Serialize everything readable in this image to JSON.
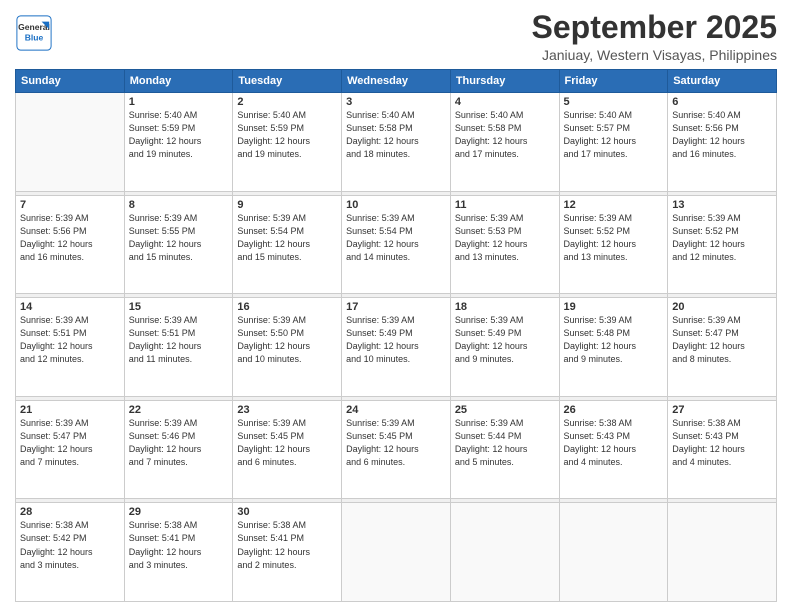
{
  "header": {
    "logo_line1": "General",
    "logo_line2": "Blue",
    "title": "September 2025",
    "subtitle": "Janiuay, Western Visayas, Philippines"
  },
  "weekdays": [
    "Sunday",
    "Monday",
    "Tuesday",
    "Wednesday",
    "Thursday",
    "Friday",
    "Saturday"
  ],
  "weeks": [
    [
      {
        "day": "",
        "info": ""
      },
      {
        "day": "1",
        "info": "Sunrise: 5:40 AM\nSunset: 5:59 PM\nDaylight: 12 hours\nand 19 minutes."
      },
      {
        "day": "2",
        "info": "Sunrise: 5:40 AM\nSunset: 5:59 PM\nDaylight: 12 hours\nand 19 minutes."
      },
      {
        "day": "3",
        "info": "Sunrise: 5:40 AM\nSunset: 5:58 PM\nDaylight: 12 hours\nand 18 minutes."
      },
      {
        "day": "4",
        "info": "Sunrise: 5:40 AM\nSunset: 5:58 PM\nDaylight: 12 hours\nand 17 minutes."
      },
      {
        "day": "5",
        "info": "Sunrise: 5:40 AM\nSunset: 5:57 PM\nDaylight: 12 hours\nand 17 minutes."
      },
      {
        "day": "6",
        "info": "Sunrise: 5:40 AM\nSunset: 5:56 PM\nDaylight: 12 hours\nand 16 minutes."
      }
    ],
    [
      {
        "day": "7",
        "info": "Sunrise: 5:39 AM\nSunset: 5:56 PM\nDaylight: 12 hours\nand 16 minutes."
      },
      {
        "day": "8",
        "info": "Sunrise: 5:39 AM\nSunset: 5:55 PM\nDaylight: 12 hours\nand 15 minutes."
      },
      {
        "day": "9",
        "info": "Sunrise: 5:39 AM\nSunset: 5:54 PM\nDaylight: 12 hours\nand 15 minutes."
      },
      {
        "day": "10",
        "info": "Sunrise: 5:39 AM\nSunset: 5:54 PM\nDaylight: 12 hours\nand 14 minutes."
      },
      {
        "day": "11",
        "info": "Sunrise: 5:39 AM\nSunset: 5:53 PM\nDaylight: 12 hours\nand 13 minutes."
      },
      {
        "day": "12",
        "info": "Sunrise: 5:39 AM\nSunset: 5:52 PM\nDaylight: 12 hours\nand 13 minutes."
      },
      {
        "day": "13",
        "info": "Sunrise: 5:39 AM\nSunset: 5:52 PM\nDaylight: 12 hours\nand 12 minutes."
      }
    ],
    [
      {
        "day": "14",
        "info": "Sunrise: 5:39 AM\nSunset: 5:51 PM\nDaylight: 12 hours\nand 12 minutes."
      },
      {
        "day": "15",
        "info": "Sunrise: 5:39 AM\nSunset: 5:51 PM\nDaylight: 12 hours\nand 11 minutes."
      },
      {
        "day": "16",
        "info": "Sunrise: 5:39 AM\nSunset: 5:50 PM\nDaylight: 12 hours\nand 10 minutes."
      },
      {
        "day": "17",
        "info": "Sunrise: 5:39 AM\nSunset: 5:49 PM\nDaylight: 12 hours\nand 10 minutes."
      },
      {
        "day": "18",
        "info": "Sunrise: 5:39 AM\nSunset: 5:49 PM\nDaylight: 12 hours\nand 9 minutes."
      },
      {
        "day": "19",
        "info": "Sunrise: 5:39 AM\nSunset: 5:48 PM\nDaylight: 12 hours\nand 9 minutes."
      },
      {
        "day": "20",
        "info": "Sunrise: 5:39 AM\nSunset: 5:47 PM\nDaylight: 12 hours\nand 8 minutes."
      }
    ],
    [
      {
        "day": "21",
        "info": "Sunrise: 5:39 AM\nSunset: 5:47 PM\nDaylight: 12 hours\nand 7 minutes."
      },
      {
        "day": "22",
        "info": "Sunrise: 5:39 AM\nSunset: 5:46 PM\nDaylight: 12 hours\nand 7 minutes."
      },
      {
        "day": "23",
        "info": "Sunrise: 5:39 AM\nSunset: 5:45 PM\nDaylight: 12 hours\nand 6 minutes."
      },
      {
        "day": "24",
        "info": "Sunrise: 5:39 AM\nSunset: 5:45 PM\nDaylight: 12 hours\nand 6 minutes."
      },
      {
        "day": "25",
        "info": "Sunrise: 5:39 AM\nSunset: 5:44 PM\nDaylight: 12 hours\nand 5 minutes."
      },
      {
        "day": "26",
        "info": "Sunrise: 5:38 AM\nSunset: 5:43 PM\nDaylight: 12 hours\nand 4 minutes."
      },
      {
        "day": "27",
        "info": "Sunrise: 5:38 AM\nSunset: 5:43 PM\nDaylight: 12 hours\nand 4 minutes."
      }
    ],
    [
      {
        "day": "28",
        "info": "Sunrise: 5:38 AM\nSunset: 5:42 PM\nDaylight: 12 hours\nand 3 minutes."
      },
      {
        "day": "29",
        "info": "Sunrise: 5:38 AM\nSunset: 5:41 PM\nDaylight: 12 hours\nand 3 minutes."
      },
      {
        "day": "30",
        "info": "Sunrise: 5:38 AM\nSunset: 5:41 PM\nDaylight: 12 hours\nand 2 minutes."
      },
      {
        "day": "",
        "info": ""
      },
      {
        "day": "",
        "info": ""
      },
      {
        "day": "",
        "info": ""
      },
      {
        "day": "",
        "info": ""
      }
    ]
  ]
}
